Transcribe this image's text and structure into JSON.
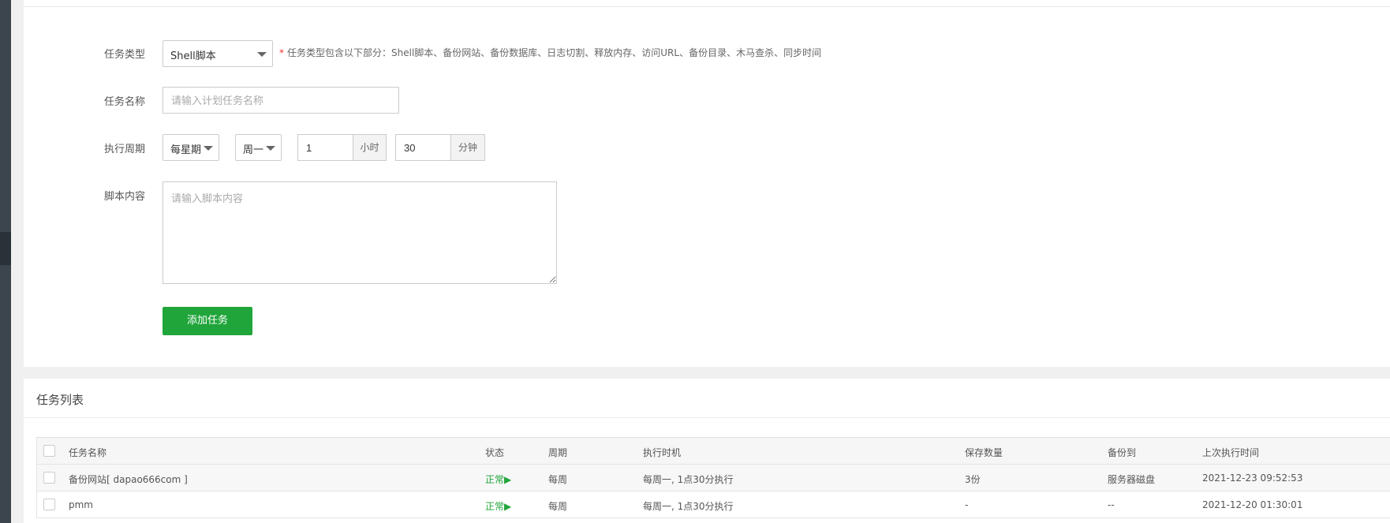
{
  "form": {
    "task_type": {
      "label": "任务类型",
      "value": "Shell脚本",
      "tip": "任务类型包含以下部分：Shell脚本、备份网站、备份数据库、日志切割、释放内存、访问URL、备份目录、木马查杀、同步时间",
      "tip_star": "*"
    },
    "task_name": {
      "label": "任务名称",
      "placeholder": "请输入计划任务名称",
      "value": ""
    },
    "cycle": {
      "label": "执行周期",
      "period": "每星期",
      "weekday": "周一",
      "hour": "1",
      "hour_unit": "小时",
      "minute": "30",
      "minute_unit": "分钟"
    },
    "script": {
      "label": "脚本内容",
      "placeholder": "请输入脚本内容"
    },
    "add_button": "添加任务"
  },
  "task_list": {
    "title": "任务列表",
    "columns": [
      "任务名称",
      "状态",
      "周期",
      "执行时机",
      "保存数量",
      "备份到",
      "上次执行时间"
    ],
    "rows": [
      {
        "name": "备份网站[ dapao666com ]",
        "status": "正常▶",
        "cycle": "每周",
        "timing": "每周一, 1点30分执行",
        "keep": "3份",
        "backup_to": "服务器磁盘",
        "last_run": "2021-12-23 09:52:53"
      },
      {
        "name": "pmm",
        "status": "正常▶",
        "cycle": "每周",
        "timing": "每周一, 1点30分执行",
        "keep": "-",
        "backup_to": "--",
        "last_run": "2021-12-20 01:30:01"
      }
    ]
  },
  "colors": {
    "accent": "#20a53a",
    "sidebar": "#3c444d"
  }
}
